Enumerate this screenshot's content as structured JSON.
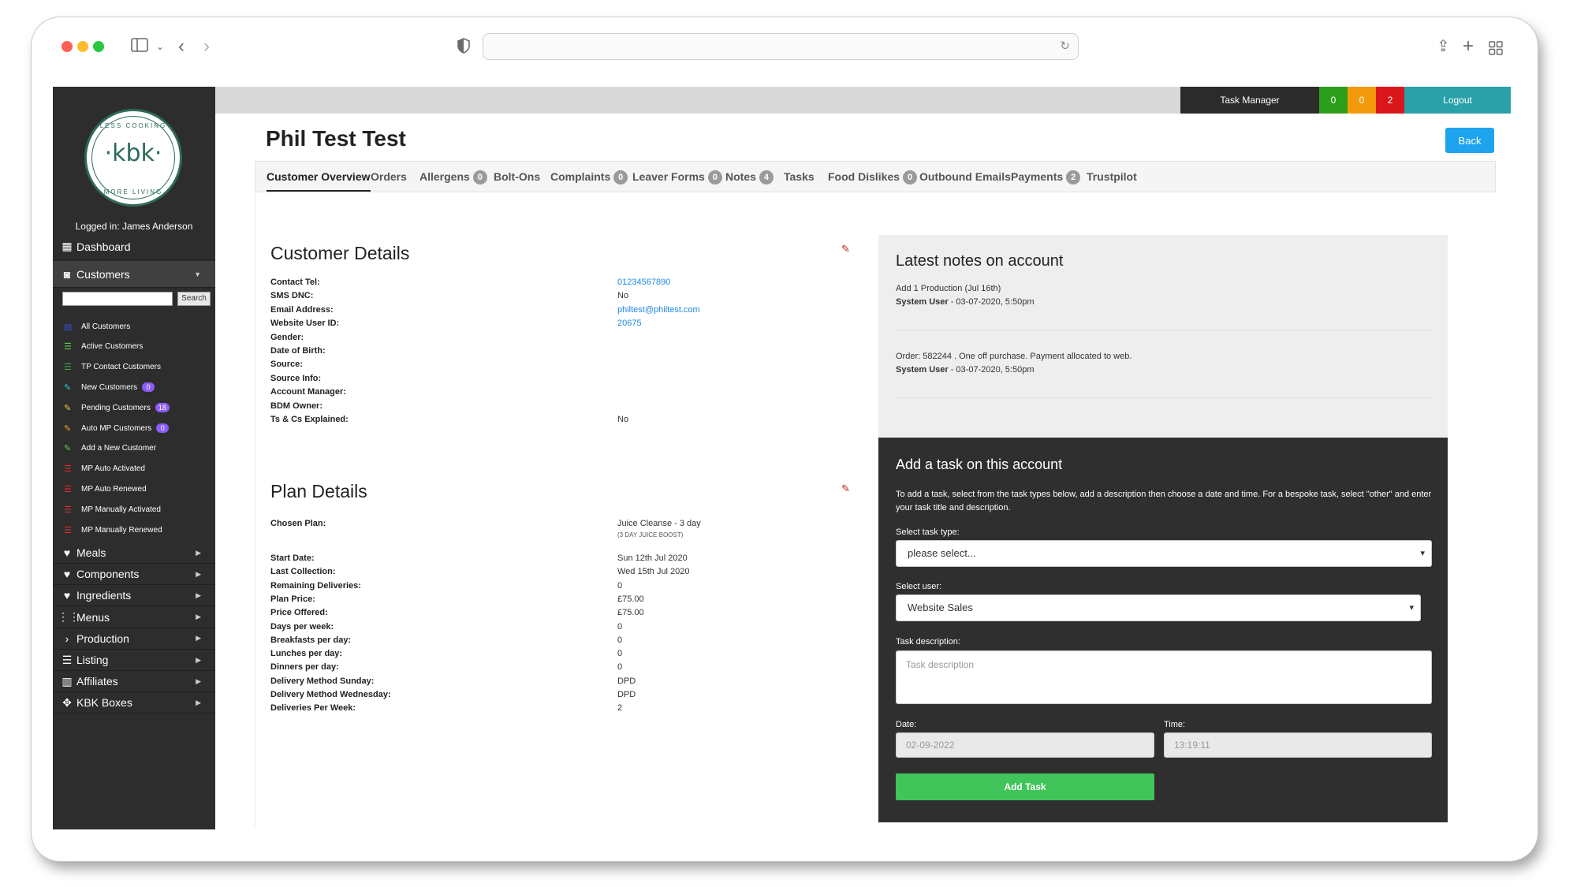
{
  "colors": {
    "accent": "#1ea3ee",
    "teal": "#2aa1a8",
    "green": "#41c45a",
    "sidebar": "#2d2d2d"
  },
  "sidebar": {
    "logo": {
      "text": "·kbk·",
      "arc_top": "LESS COOKING",
      "arc_bottom": "MORE LIVING"
    },
    "logged_in": "Logged in: James Anderson",
    "dashboard": "Dashboard",
    "customers": "Customers",
    "search_button": "Search",
    "sub_items": [
      {
        "label": "All Customers",
        "icon_color": "#3b4bd8",
        "badge": ""
      },
      {
        "label": "Active Customers",
        "icon_color": "#5ad24a",
        "badge": ""
      },
      {
        "label": "TP Contact Customers",
        "icon_color": "#3da34a",
        "badge": ""
      },
      {
        "label": "New Customers",
        "icon_color": "#31c6d8",
        "badge": "0"
      },
      {
        "label": "Pending Customers",
        "icon_color": "#e6d22e",
        "badge": "18"
      },
      {
        "label": "Auto MP Customers",
        "icon_color": "#f0a02a",
        "badge": "0"
      },
      {
        "label": "Add a New Customer",
        "icon_color": "#5ad24a",
        "badge": ""
      },
      {
        "label": "MP Auto Activated",
        "icon_color": "#d83030",
        "badge": ""
      },
      {
        "label": "MP Auto Renewed",
        "icon_color": "#d83030",
        "badge": ""
      },
      {
        "label": "MP Manually Activated",
        "icon_color": "#d83030",
        "badge": ""
      },
      {
        "label": "MP Manually Renewed",
        "icon_color": "#d83030",
        "badge": ""
      }
    ],
    "nav": [
      "Meals",
      "Components",
      "Ingredients",
      "Menus",
      "Production",
      "Listing",
      "Affiliates",
      "KBK Boxes"
    ]
  },
  "topbar": {
    "task_manager": "Task Manager",
    "count_green": "0",
    "count_orange": "0",
    "count_red": "2",
    "logout": "Logout"
  },
  "page": {
    "title": "Phil Test Test",
    "back": "Back"
  },
  "tabs": [
    {
      "label": "Customer Overview",
      "badge": ""
    },
    {
      "label": "Orders",
      "badge": ""
    },
    {
      "label": "Allergens",
      "badge": "0"
    },
    {
      "label": "Bolt-Ons",
      "badge": ""
    },
    {
      "label": "Complaints",
      "badge": "0"
    },
    {
      "label": "Leaver Forms",
      "badge": "0"
    },
    {
      "label": "Notes",
      "badge": "4"
    },
    {
      "label": "Tasks",
      "badge": ""
    },
    {
      "label": "Food Dislikes",
      "badge": "0"
    },
    {
      "label": "Outbound Emails",
      "badge": ""
    },
    {
      "label": "Payments",
      "badge": "2"
    },
    {
      "label": "Trustpilot",
      "badge": ""
    }
  ],
  "customer_details": {
    "title": "Customer Details",
    "rows": [
      {
        "label": "Contact Tel:",
        "value": "01234567890"
      },
      {
        "label": "SMS DNC:",
        "value": "No"
      },
      {
        "label": "Email Address:",
        "value": "philtest@philtest.com"
      },
      {
        "label": "Website User ID:",
        "value": "20675"
      },
      {
        "label": "Gender:",
        "value": ""
      },
      {
        "label": "Date of Birth:",
        "value": ""
      },
      {
        "label": "Source:",
        "value": ""
      },
      {
        "label": "Source Info:",
        "value": ""
      },
      {
        "label": "Account Manager:",
        "value": ""
      },
      {
        "label": "BDM Owner:",
        "value": ""
      },
      {
        "label": "Ts & Cs Explained:",
        "value": "No"
      }
    ]
  },
  "plan_details": {
    "title": "Plan Details",
    "chosen_plan_label": "Chosen Plan:",
    "chosen_plan_value": "Juice Cleanse - 3 day",
    "chosen_plan_sub": "(3 DAY JUICE BOOST)",
    "rows": [
      {
        "label": "Start Date:",
        "value": "Sun 12th Jul 2020"
      },
      {
        "label": "Last Collection:",
        "value": "Wed 15th Jul 2020"
      },
      {
        "label": "Remaining Deliveries:",
        "value": "0"
      },
      {
        "label": "Plan Price:",
        "value": "£75.00"
      },
      {
        "label": "Price Offered:",
        "value": "£75.00"
      },
      {
        "label": "Days per week:",
        "value": "0"
      },
      {
        "label": "Breakfasts per day:",
        "value": "0"
      },
      {
        "label": "Lunches per day:",
        "value": "0"
      },
      {
        "label": "Dinners per day:",
        "value": "0"
      },
      {
        "label": "Delivery Method Sunday:",
        "value": "DPD"
      },
      {
        "label": "Delivery Method Wednesday:",
        "value": "DPD"
      },
      {
        "label": "Deliveries Per Week:",
        "value": "2"
      }
    ]
  },
  "notes": {
    "title": "Latest notes on account",
    "items": [
      {
        "text": "Add 1 Production (Jul 16th)",
        "author": "System User",
        "date": " - 03-07-2020, 5:50pm"
      },
      {
        "text": "Order: 582244 . One off purchase. Payment allocated to web.",
        "author": "System User",
        "date": " - 03-07-2020, 5:50pm"
      }
    ]
  },
  "task": {
    "title": "Add a task on this account",
    "description": "To add a task, select from the task types below, add a description then choose a date and time. For a bespoke task, select \"other\" and enter your task title and description.",
    "type_label": "Select task type:",
    "type_value": "please select...",
    "user_label": "Select user:",
    "user_value": "Website Sales",
    "desc_label": "Task description:",
    "desc_placeholder": "Task description",
    "date_label": "Date:",
    "date_value": "02-09-2022",
    "time_label": "Time:",
    "time_value": "13:19:11",
    "add_button": "Add Task"
  }
}
